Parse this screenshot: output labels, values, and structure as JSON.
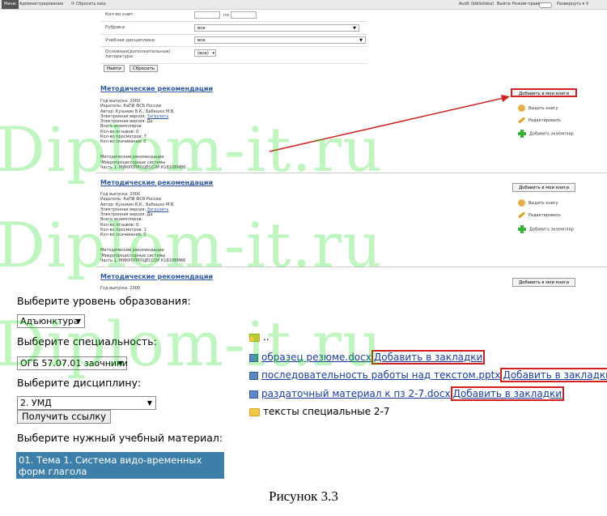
{
  "topbar": {
    "menu": "Меню",
    "admin": "Администрирование",
    "reset_cache": "Сбросить кеш",
    "user": "Audit (biblioteka)",
    "logout": "Выйти",
    "edit_mode": "Режим правки",
    "expand": "Развернуть"
  },
  "search_form": {
    "count_label": "Кол-во книг:",
    "count_to": "по",
    "rubric_label": "Рубрика:",
    "rubric_value": "все",
    "discipline_label": "Учебная дисциплина:",
    "discipline_value": "все",
    "main_label_1": "Основная(дополнительная)",
    "main_label_2": "литература:",
    "main_value": "(все)",
    "find_button": "Найти",
    "reset_button": "Сбросить"
  },
  "records": [
    {
      "title": "Методические рекомендации",
      "year": "Год выпуска: 2000",
      "publisher": "Издатель: КаПИ ФСБ России",
      "author": "Автор: Кузьмин В.К., Бабешко М.В.",
      "ebook": "Электронная версия:",
      "download": "Загрузить",
      "ebook2": "Электронная версия: Да",
      "copies": "Всего экземпляров:",
      "reviews": "Кол-во отзывов: 0",
      "views": "Кол-во просмотров: 7",
      "downloads": "Кол-во скачиваний: 0",
      "desc1": "Методические рекомендации",
      "desc2": "'Микропроцессорные системы",
      "desc3": "Часть 1. МИКРОПРОЦЕССОР К1810ВМ86"
    },
    {
      "title": "Методические рекомендации",
      "year": "Год выпуска: 2000",
      "publisher": "Издатель: КаПИ ФСБ России",
      "author": "Автор: Кузьмин В.К., Бабешко М.В.",
      "ebook": "Электронная версия:",
      "download": "Загрузить",
      "ebook2": "Электронная версия: Да",
      "copies": "Всего экземпляров:",
      "reviews": "Кол-во отзывов: 0",
      "views": "Кол-во просмотров: 1",
      "downloads": "Кол-во скачиваний: 0",
      "desc1": "Методические рекомендации",
      "desc2": "'Микропроцессорные системы",
      "desc3": "Часть 1. МИКРОПРОЦЕССОР К1810ВМ86"
    },
    {
      "title": "Методические рекомендации",
      "year": "Год выпуска: 2000"
    }
  ],
  "actions": {
    "add_to_my_books": "Добавить в мои книги",
    "issue_book": "Выдать книгу",
    "edit": "Редактировать",
    "add_copy": "Добавить экземпляр"
  },
  "watermark": "Diplom-it.ru",
  "materials_form": {
    "level_label": "Выберите уровень образования:",
    "level_value": "Адъюнктура",
    "specialty_label": "Выберите специальность:",
    "specialty_value": "ОГБ 57.07.01 заочники",
    "discipline_label": "Выберите дисциплину:",
    "discipline_value": "2. УМД",
    "get_link_button": "Получить ссылку",
    "material_label": "Выберите нужный учебный материал:",
    "material_selected": "01. Тема 1. Система видо-временных форм глагола"
  },
  "files": {
    "parent": "..",
    "items": [
      {
        "name": "образец резюме.docx",
        "bookmark": "Добавить в закладки"
      },
      {
        "name": "последовательность работы над текстом.pptx",
        "bookmark": "Добавить в закладки"
      },
      {
        "name": "раздаточный материал к пз 2-7.docx",
        "bookmark": "Добавить в закладки"
      }
    ],
    "folder": "тексты специальные 2-7"
  },
  "caption": "Рисунок 3.3"
}
